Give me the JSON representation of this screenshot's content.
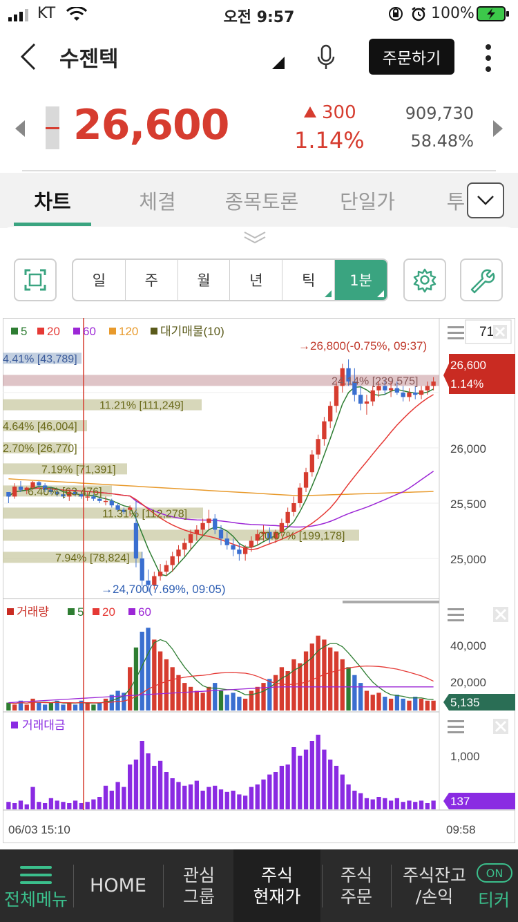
{
  "status": {
    "carrier": "KT",
    "time": "오전 9:57",
    "battery": "100%"
  },
  "header": {
    "title": "수젠텍",
    "order_label": "주문하기"
  },
  "quote": {
    "price": "26,600",
    "change": "300",
    "change_pct": "1.14%",
    "volume": "909,730",
    "turnover_pct": "58.48%"
  },
  "tabs": [
    "차트",
    "체결",
    "종목토론",
    "단일가",
    "투"
  ],
  "periods": [
    "일",
    "주",
    "월",
    "년",
    "틱",
    "1분"
  ],
  "legend": {
    "ma5": "5",
    "ma20": "20",
    "ma60": "60",
    "ma120": "120",
    "supply": "대기매물(10)",
    "period_count": "71",
    "vol_title": "거래량",
    "vol_ma5": "5",
    "vol_ma20": "20",
    "vol_ma60": "60",
    "amt_title": "거래대금"
  },
  "price_axis": {
    "labels": [
      "26,000",
      "25,500",
      "25,000"
    ],
    "current": "26,600",
    "current_pct": "1.14%"
  },
  "vol_axis": {
    "labels": [
      "40,000",
      "20,000"
    ],
    "current": "5,135"
  },
  "amt_axis": {
    "labels": [
      "1,000"
    ],
    "current": "137"
  },
  "annotations": {
    "high": "26,800(-0.75%, 09:37)",
    "low": "24,700(7.69%, 09:05)"
  },
  "supply_zones": [
    "4.41% [43,789]",
    "24.14% [239,575]",
    "11.21% [111,249]",
    "4.64% [46,004]",
    "2.70% [26,770]",
    "7.19% [71,391]",
    "6.40% [63,476]",
    "11.31% [112,278]",
    "20.07% [199,178]",
    "7.94% [78,824]"
  ],
  "time_axis": {
    "start": "06/03 15:10",
    "end": "09:58"
  },
  "bottom_nav": {
    "menu": "전체메뉴",
    "home": "HOME",
    "watch1": "관심",
    "watch2": "그룹",
    "quote1": "주식",
    "quote2": "현재가",
    "order1": "주식",
    "order2": "주문",
    "bal1": "주식잔고",
    "bal2": "/손익",
    "ticker_on": "ON",
    "ticker": "티커"
  },
  "colors": {
    "up": "#d63c2f",
    "down": "#3a6fd0",
    "accent": "#3aa480",
    "ma5": "#2e7d32",
    "ma20": "#e53935",
    "ma60": "#9c27d6",
    "ma120": "#e89a2c",
    "supply": "#5a5a1a"
  },
  "chart_data": {
    "type": "candlestick",
    "title": "",
    "xlabel": "",
    "ylabel": "",
    "ylim": [
      24600,
      27000
    ],
    "candles": [
      [
        25600,
        25600,
        25500,
        25560
      ],
      [
        25560,
        25680,
        25540,
        25650
      ],
      [
        25650,
        25700,
        25600,
        25620
      ],
      [
        25620,
        25650,
        25580,
        25640
      ],
      [
        25640,
        25700,
        25620,
        25690
      ],
      [
        25690,
        25700,
        25640,
        25660
      ],
      [
        25660,
        25680,
        25600,
        25620
      ],
      [
        25620,
        25650,
        25580,
        25600
      ],
      [
        25600,
        25620,
        25560,
        25580
      ],
      [
        25580,
        25600,
        25540,
        25560
      ],
      [
        25560,
        25620,
        25520,
        25600
      ],
      [
        25600,
        25620,
        25560,
        25580
      ],
      [
        25580,
        25600,
        25540,
        25560
      ],
      [
        25560,
        25600,
        25520,
        25560
      ],
      [
        25560,
        25580,
        25520,
        25540
      ],
      [
        25540,
        25560,
        25500,
        25520
      ],
      [
        25520,
        25560,
        25480,
        25520
      ],
      [
        25520,
        25540,
        25460,
        25480
      ],
      [
        25480,
        25500,
        25420,
        25440
      ],
      [
        25440,
        25460,
        25400,
        25420
      ],
      [
        25440,
        25480,
        25380,
        25460
      ],
      [
        25320,
        25520,
        24920,
        25000
      ],
      [
        25000,
        25060,
        24750,
        24800
      ],
      [
        24800,
        24900,
        24700,
        24760
      ],
      [
        24760,
        24880,
        24720,
        24840
      ],
      [
        24840,
        24950,
        24800,
        24880
      ],
      [
        24880,
        24980,
        24840,
        24940
      ],
      [
        24940,
        25060,
        24880,
        25020
      ],
      [
        25020,
        25120,
        24960,
        25080
      ],
      [
        25080,
        25180,
        25020,
        25140
      ],
      [
        25140,
        25260,
        25080,
        25220
      ],
      [
        25220,
        25300,
        25160,
        25260
      ],
      [
        25260,
        25360,
        25200,
        25320
      ],
      [
        25320,
        25440,
        25260,
        25360
      ],
      [
        25360,
        25400,
        25220,
        25260
      ],
      [
        25260,
        25300,
        25120,
        25180
      ],
      [
        25180,
        25240,
        25080,
        25120
      ],
      [
        25120,
        25180,
        25020,
        25080
      ],
      [
        25080,
        25140,
        24980,
        25040
      ],
      [
        25040,
        25120,
        24980,
        25100
      ],
      [
        25100,
        25200,
        25060,
        25160
      ],
      [
        25160,
        25260,
        25120,
        25220
      ],
      [
        25220,
        25300,
        25160,
        25240
      ],
      [
        25240,
        25280,
        25140,
        25180
      ],
      [
        25180,
        25260,
        25140,
        25240
      ],
      [
        25240,
        25360,
        25200,
        25320
      ],
      [
        25320,
        25460,
        25280,
        25420
      ],
      [
        25420,
        25560,
        25380,
        25500
      ],
      [
        25500,
        25680,
        25460,
        25640
      ],
      [
        25640,
        25820,
        25600,
        25780
      ],
      [
        25780,
        25980,
        25740,
        25940
      ],
      [
        25940,
        26120,
        25900,
        26080
      ],
      [
        26080,
        26280,
        26020,
        26240
      ],
      [
        26240,
        26420,
        26180,
        26380
      ],
      [
        26380,
        26600,
        26320,
        26560
      ],
      [
        26560,
        26760,
        26500,
        26720
      ],
      [
        26720,
        26800,
        26560,
        26600
      ],
      [
        26600,
        26720,
        26420,
        26480
      ],
      [
        26480,
        26560,
        26340,
        26400
      ],
      [
        26400,
        26480,
        26300,
        26420
      ],
      [
        26420,
        26560,
        26380,
        26520
      ],
      [
        26520,
        26600,
        26460,
        26560
      ],
      [
        26560,
        26620,
        26480,
        26520
      ],
      [
        26520,
        26600,
        26460,
        26540
      ],
      [
        26540,
        26600,
        26480,
        26500
      ],
      [
        26500,
        26560,
        26420,
        26460
      ],
      [
        26460,
        26540,
        26420,
        26500
      ],
      [
        26500,
        26560,
        26440,
        26480
      ],
      [
        26480,
        26560,
        26440,
        26520
      ],
      [
        26520,
        26600,
        26480,
        26560
      ],
      [
        26560,
        26640,
        26520,
        26600
      ]
    ],
    "supply_levels": [
      {
        "price_from": 26860,
        "price_to": 26760,
        "pct": 4.41
      },
      {
        "price_from": 26660,
        "price_to": 26560,
        "pct": 24.14
      },
      {
        "price_from": 26440,
        "price_to": 26340,
        "pct": 11.21
      },
      {
        "price_from": 26250,
        "price_to": 26150,
        "pct": 4.64
      },
      {
        "price_from": 26050,
        "price_to": 25950,
        "pct": 2.7
      },
      {
        "price_from": 25860,
        "price_to": 25760,
        "pct": 7.19
      },
      {
        "price_from": 25660,
        "price_to": 25560,
        "pct": 6.4
      },
      {
        "price_from": 25460,
        "price_to": 25360,
        "pct": 11.31
      },
      {
        "price_from": 25260,
        "price_to": 25160,
        "pct": 20.07
      },
      {
        "price_from": 25060,
        "price_to": 24960,
        "pct": 7.94
      }
    ],
    "volume": [
      4,
      3,
      5,
      3,
      6,
      4,
      3,
      4,
      5,
      3,
      4,
      3,
      5,
      4,
      3,
      4,
      6,
      8,
      10,
      9,
      22,
      32,
      40,
      42,
      36,
      30,
      26,
      22,
      18,
      14,
      12,
      10,
      9,
      12,
      14,
      10,
      8,
      9,
      7,
      6,
      10,
      12,
      14,
      16,
      18,
      22,
      20,
      26,
      24,
      30,
      34,
      38,
      36,
      32,
      30,
      26,
      22,
      18,
      14,
      10,
      8,
      9,
      7,
      6,
      8,
      6,
      5,
      7,
      6,
      5,
      5
    ],
    "amount": [
      12,
      10,
      14,
      8,
      36,
      12,
      10,
      18,
      14,
      12,
      10,
      14,
      10,
      12,
      16,
      20,
      38,
      30,
      44,
      36,
      72,
      80,
      110,
      90,
      70,
      78,
      60,
      50,
      44,
      38,
      40,
      46,
      30,
      36,
      38,
      32,
      28,
      30,
      24,
      22,
      36,
      40,
      48,
      56,
      60,
      70,
      72,
      100,
      86,
      96,
      110,
      120,
      96,
      80,
      70,
      56,
      40,
      30,
      26,
      18,
      16,
      20,
      18,
      14,
      18,
      12,
      14,
      12,
      14,
      10,
      14
    ]
  }
}
